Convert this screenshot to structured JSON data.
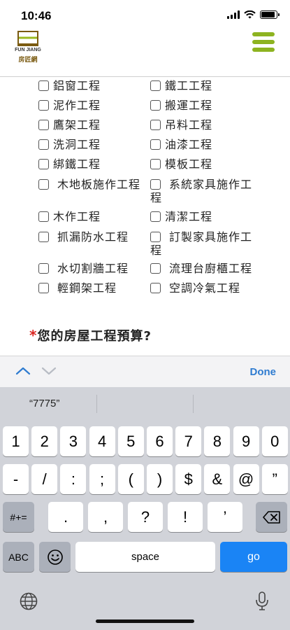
{
  "status_bar": {
    "time": "10:46",
    "battery_level": 0.9
  },
  "site_header": {
    "logo_text_en": "FUN JIANG",
    "logo_text_zh": "房匠網",
    "menu_icon": "hamburger-menu-icon"
  },
  "form": {
    "options": [
      {
        "label": "鋁窗工程"
      },
      {
        "label": "鐵工工程"
      },
      {
        "label": "泥作工程"
      },
      {
        "label": "搬運工程"
      },
      {
        "label": "鷹架工程"
      },
      {
        "label": "吊料工程"
      },
      {
        "label": "洗洞工程"
      },
      {
        "label": "油漆工程"
      },
      {
        "label": "綁鐵工程"
      },
      {
        "label": "模板工程"
      },
      {
        "label": "木地板施作工程"
      },
      {
        "label": "系統家具施作工"
      },
      {
        "label": "程"
      },
      {
        "label": "木作工程"
      },
      {
        "label": "清潔工程"
      },
      {
        "label": "抓漏防水工程"
      },
      {
        "label": "訂製家具施作工"
      },
      {
        "label": "程"
      },
      {
        "label": "水切割牆工程"
      },
      {
        "label": "流理台廚櫃工程"
      },
      {
        "label": "輕鋼架工程"
      },
      {
        "label": "空調冷氣工程"
      }
    ],
    "required_mark": "*",
    "budget_question": "您的房屋工程預算?"
  },
  "accessory_bar": {
    "done_label": "Done"
  },
  "keyboard": {
    "suggestion": "“7775”",
    "row1": [
      "1",
      "2",
      "3",
      "4",
      "5",
      "6",
      "7",
      "8",
      "9",
      "0"
    ],
    "row2": [
      "-",
      "/",
      ":",
      ";",
      "(",
      ")",
      "$",
      "&",
      "@",
      "”"
    ],
    "row3": [
      ".",
      ",",
      "?",
      "!",
      "’"
    ],
    "symbols_key": "#+=",
    "abc_key": "ABC",
    "space_key": "space",
    "go_key": "go"
  },
  "colors": {
    "accent_green": "#8db320",
    "required_red": "#d9231f",
    "ios_blue": "#1a84f5"
  }
}
